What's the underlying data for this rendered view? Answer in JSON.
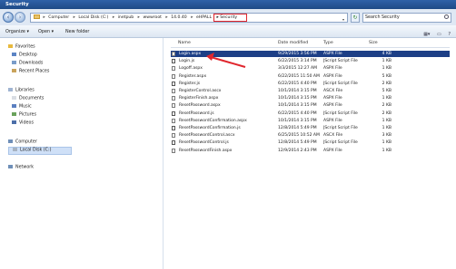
{
  "window": {
    "title": "Security"
  },
  "address": {
    "segments": [
      "Computer",
      "Local Disk (C:)",
      "inetpub",
      "wwwroot",
      "14.0.40",
      "eHPALL"
    ],
    "active": "Security"
  },
  "search": {
    "placeholder": "Search Security"
  },
  "toolbar": {
    "organize": "Organize ▾",
    "include": "Open ▾",
    "new_folder": "New folder"
  },
  "nav": {
    "favorites": "Favorites",
    "desktop": "Desktop",
    "downloads": "Downloads",
    "recent": "Recent Places",
    "libraries": "Libraries",
    "documents": "Documents",
    "music": "Music",
    "pictures": "Pictures",
    "videos": "Videos",
    "computer": "Computer",
    "local_disk": "Local Disk (C:)",
    "network": "Network"
  },
  "columns": {
    "name": "Name",
    "date": "Date modified",
    "type": "Type",
    "size": "Size"
  },
  "files": [
    {
      "name": "Login.aspx",
      "date": "9/29/2015 3:56 PM",
      "type": "ASPX File",
      "size": "4 KB"
    },
    {
      "name": "Login.js",
      "date": "6/22/2015 3:14 PM",
      "type": "JScript Script File",
      "size": "1 KB"
    },
    {
      "name": "Logoff.aspx",
      "date": "3/3/2015 12:27 AM",
      "type": "ASPX File",
      "size": "1 KB"
    },
    {
      "name": "Register.aspx",
      "date": "6/22/2015 11:50 AM",
      "type": "ASPX File",
      "size": "5 KB"
    },
    {
      "name": "Register.js",
      "date": "6/22/2015 4:40 PM",
      "type": "JScript Script File",
      "size": "2 KB"
    },
    {
      "name": "RegisterControl.ascx",
      "date": "10/1/2014 3:15 PM",
      "type": "ASCX File",
      "size": "5 KB"
    },
    {
      "name": "RegisterFinish.aspx",
      "date": "10/1/2014 3:15 PM",
      "type": "ASPX File",
      "size": "1 KB"
    },
    {
      "name": "ResetPassword.aspx",
      "date": "10/1/2014 3:15 PM",
      "type": "ASPX File",
      "size": "2 KB"
    },
    {
      "name": "ResetPassword.js",
      "date": "6/22/2015 4:40 PM",
      "type": "JScript Script File",
      "size": "2 KB"
    },
    {
      "name": "ResetPasswordConfirmation.aspx",
      "date": "10/1/2014 3:15 PM",
      "type": "ASPX File",
      "size": "1 KB"
    },
    {
      "name": "ResetPasswordConfirmation.js",
      "date": "12/8/2014 5:49 PM",
      "type": "JScript Script File",
      "size": "1 KB"
    },
    {
      "name": "ResetPasswordControl.ascx",
      "date": "6/25/2015 10:52 AM",
      "type": "ASCX File",
      "size": "3 KB"
    },
    {
      "name": "ResetPasswordControl.js",
      "date": "12/8/2014 5:49 PM",
      "type": "JScript Script File",
      "size": "1 KB"
    },
    {
      "name": "ResetPasswordFinish.aspx",
      "date": "12/9/2014 2:43 PM",
      "type": "ASPX File",
      "size": "1 KB"
    }
  ]
}
